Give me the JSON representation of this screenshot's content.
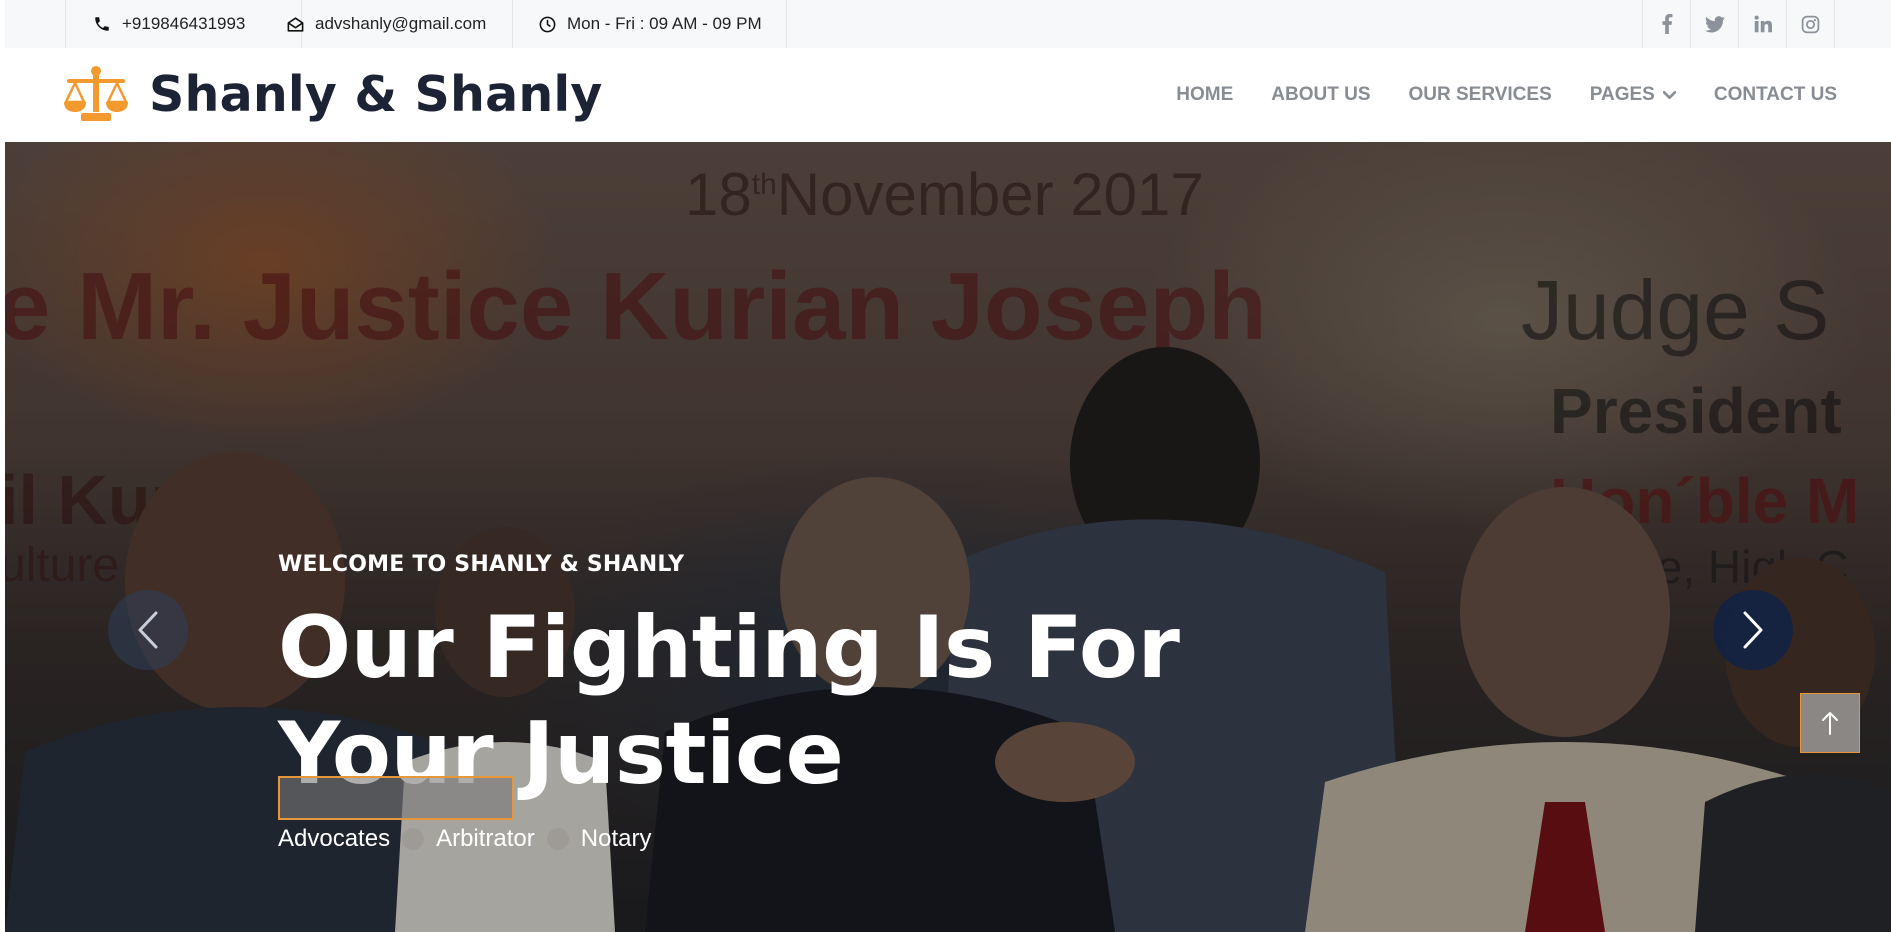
{
  "topbar": {
    "phone": "+919846431993",
    "email": "advshanly@gmail.com",
    "hours": "Mon - Fri : 09 AM - 09 PM",
    "socials": [
      {
        "name": "facebook-icon",
        "glyph": "f"
      },
      {
        "name": "twitter-icon",
        "glyph": ""
      },
      {
        "name": "linkedin-icon",
        "glyph": "in"
      },
      {
        "name": "instagram-icon",
        "glyph": ""
      }
    ]
  },
  "brand": {
    "name": "Shanly & Shanly",
    "logo_icon": "scales-of-justice-icon",
    "accent": "#f29a2e"
  },
  "nav": {
    "items": [
      "HOME",
      "ABOUT US",
      "OUR SERVICES",
      "PAGES",
      "CONTACT US"
    ]
  },
  "hero": {
    "bg_text": {
      "date_day": "18",
      "date_sup": "th",
      "date_rest": "November  2017",
      "name": "e Mr. Justice Kurian Joseph",
      "judge": "Judge S",
      "president": "President",
      "honble": "Hon´ble M",
      "highcourt": "Judge, High C",
      "kumar": "il Kumar",
      "culture": "ulture"
    },
    "eyebrow": "WELCOME TO SHANLY & SHANLY",
    "headline": "Our Fighting Is For Your Justice",
    "tags": [
      "Advocates",
      "Arbitrator",
      "Notary"
    ]
  },
  "colors": {
    "dark": "#1c2334",
    "nav_text": "#888c93",
    "accent": "#e7963a"
  }
}
